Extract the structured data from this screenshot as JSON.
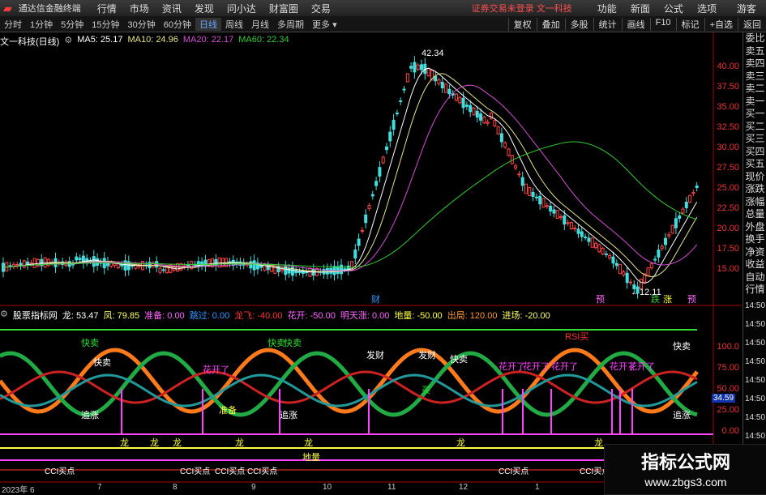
{
  "menubar": {
    "app_title": "通达信金融终端",
    "items": [
      "行情",
      "市场",
      "资讯",
      "发现",
      "问小达",
      "财富圈",
      "交易"
    ],
    "login_notice": "证券交易未登录",
    "stock_name": "文一科技",
    "right_items": [
      "功能",
      "新面",
      "公式",
      "选项"
    ],
    "guest": "游客"
  },
  "periods": [
    "分时",
    "1分钟",
    "5分钟",
    "15分钟",
    "30分钟",
    "60分钟",
    "日线",
    "周线",
    "月线",
    "多周期",
    "更多"
  ],
  "active_period": "日线",
  "tools": [
    "复权",
    "叠加",
    "多股",
    "统计",
    "画线",
    "F10",
    "标记",
    "+自选",
    "返回"
  ],
  "main": {
    "title": "文一科技(日线)",
    "ma": [
      {
        "label": "MA5: 25.17",
        "color": "#ffffff"
      },
      {
        "label": "MA10: 24.96",
        "color": "#e8e38a"
      },
      {
        "label": "MA20: 22.17",
        "color": "#d24fd2"
      },
      {
        "label": "MA60: 22.34",
        "color": "#33cc33"
      }
    ],
    "price_ticks": [
      "40.00",
      "37.50",
      "35.00",
      "32.50",
      "30.00",
      "27.50",
      "25.00",
      "22.50",
      "20.00",
      "17.50",
      "15.00"
    ],
    "high_label": "42.34",
    "low_label": "12.11",
    "markers": [
      "财",
      "预",
      "跌",
      "涨",
      "预"
    ]
  },
  "indicator": {
    "title": "股票指标网",
    "params": [
      {
        "label": "龙: 53.47",
        "color": "#ffffff"
      },
      {
        "label": "凤: 79.85",
        "color": "#ffff66"
      },
      {
        "label": "准备: 0.00",
        "color": "#ff66ff"
      },
      {
        "label": "跳过: 0.00",
        "color": "#3399ff"
      },
      {
        "label": "龙飞: -40.00",
        "color": "#ff3333"
      },
      {
        "label": "花开: -50.00",
        "color": "#ff66ff"
      },
      {
        "label": "明天涨: 0.00",
        "color": "#ff66ff"
      },
      {
        "label": "地量: -50.00",
        "color": "#ffff33"
      },
      {
        "label": "出局: 120.00",
        "color": "#ff9933"
      },
      {
        "label": "进场: -20.00",
        "color": "#ffff66"
      }
    ],
    "ticks": [
      "100.0",
      "75.00",
      "50.00",
      "25.00",
      "0.00"
    ],
    "current": "34.59",
    "annotations": {
      "kuaimai": "快卖",
      "kuaimai2": "快卖",
      "rsi": "RSI买",
      "huakai": "花开了",
      "zhuizhang": "追涨",
      "zhunbei": "准备",
      "long": "龙",
      "diliang": "地量",
      "cci": "CCI买点",
      "facai": "发财",
      "buy": "买"
    }
  },
  "dates": [
    "2023年 6",
    "7",
    "8",
    "9",
    "10",
    "11",
    "12",
    "1"
  ],
  "side_panel": [
    "委比",
    "卖五",
    "卖四",
    "卖三",
    "卖二",
    "卖一",
    "买一",
    "买二",
    "买三",
    "买四",
    "买五",
    "现价",
    "涨跌",
    "涨幅",
    "总量",
    "外盘",
    "换手",
    "净资",
    "收益",
    "自动",
    "行情",
    "14:50",
    "14:50",
    "14:50",
    "14:50",
    "14:50",
    "14:50",
    "14:50",
    "14:50"
  ],
  "watermark": {
    "title": "指标公式网",
    "url": "www.zbgs3.com"
  }
}
